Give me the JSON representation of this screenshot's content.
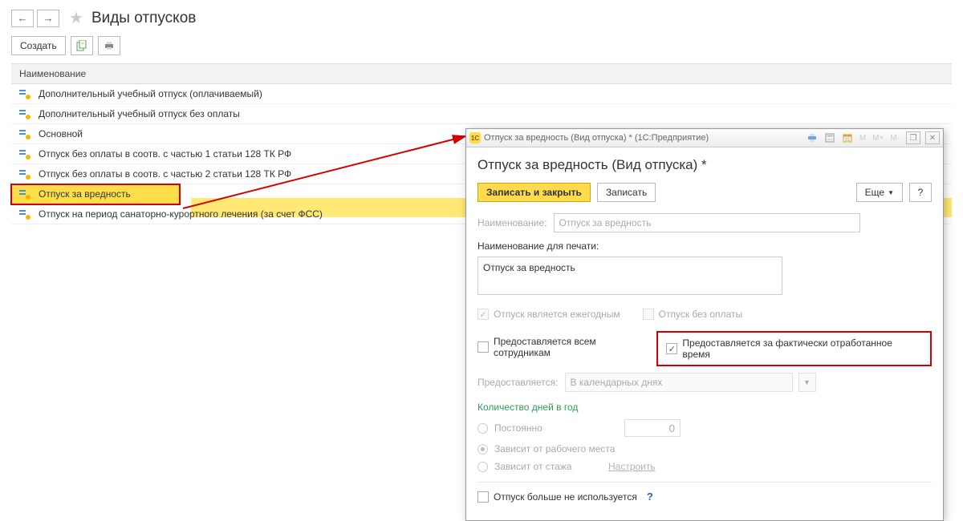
{
  "header": {
    "title": "Виды отпусков"
  },
  "toolbar": {
    "create_label": "Создать"
  },
  "table": {
    "header_name": "Наименование",
    "rows": [
      "Дополнительный учебный отпуск (оплачиваемый)",
      "Дополнительный учебный отпуск без оплаты",
      "Основной",
      "Отпуск без оплаты в соотв. с частью 1 статьи 128 ТК РФ",
      "Отпуск без оплаты в соотв. с частью 2 статьи 128 ТК РФ",
      "Отпуск за вредность",
      "Отпуск на период санаторно-курортного лечения (за счет ФСС)"
    ]
  },
  "dialog": {
    "titlebar": "Отпуск за вредность (Вид отпуска) * (1С:Предприятие)",
    "heading": "Отпуск за вредность (Вид отпуска) *",
    "buttons": {
      "save_close": "Записать и закрыть",
      "save": "Записать",
      "more": "Еще",
      "help": "?"
    },
    "fields": {
      "name_label": "Наименование:",
      "name_value": "Отпуск за вредность",
      "print_name_label": "Наименование для печати:",
      "print_name_value": "Отпуск за вредность",
      "annual_label": "Отпуск является ежегодным",
      "unpaid_label": "Отпуск без оплаты",
      "all_emp_label": "Предоставляется всем сотрудникам",
      "worked_time_label": "Предоставляется за фактически отработанное время",
      "granted_label": "Предоставляется:",
      "granted_value": "В календарных днях",
      "days_per_year_label": "Количество дней в год",
      "constant_label": "Постоянно",
      "constant_value": "0",
      "by_workplace_label": "Зависит от рабочего места",
      "by_seniority_label": "Зависит от стажа",
      "configure_link": "Настроить",
      "not_used_label": "Отпуск больше не используется",
      "m_icons": [
        "M",
        "M+",
        "M-"
      ]
    }
  }
}
